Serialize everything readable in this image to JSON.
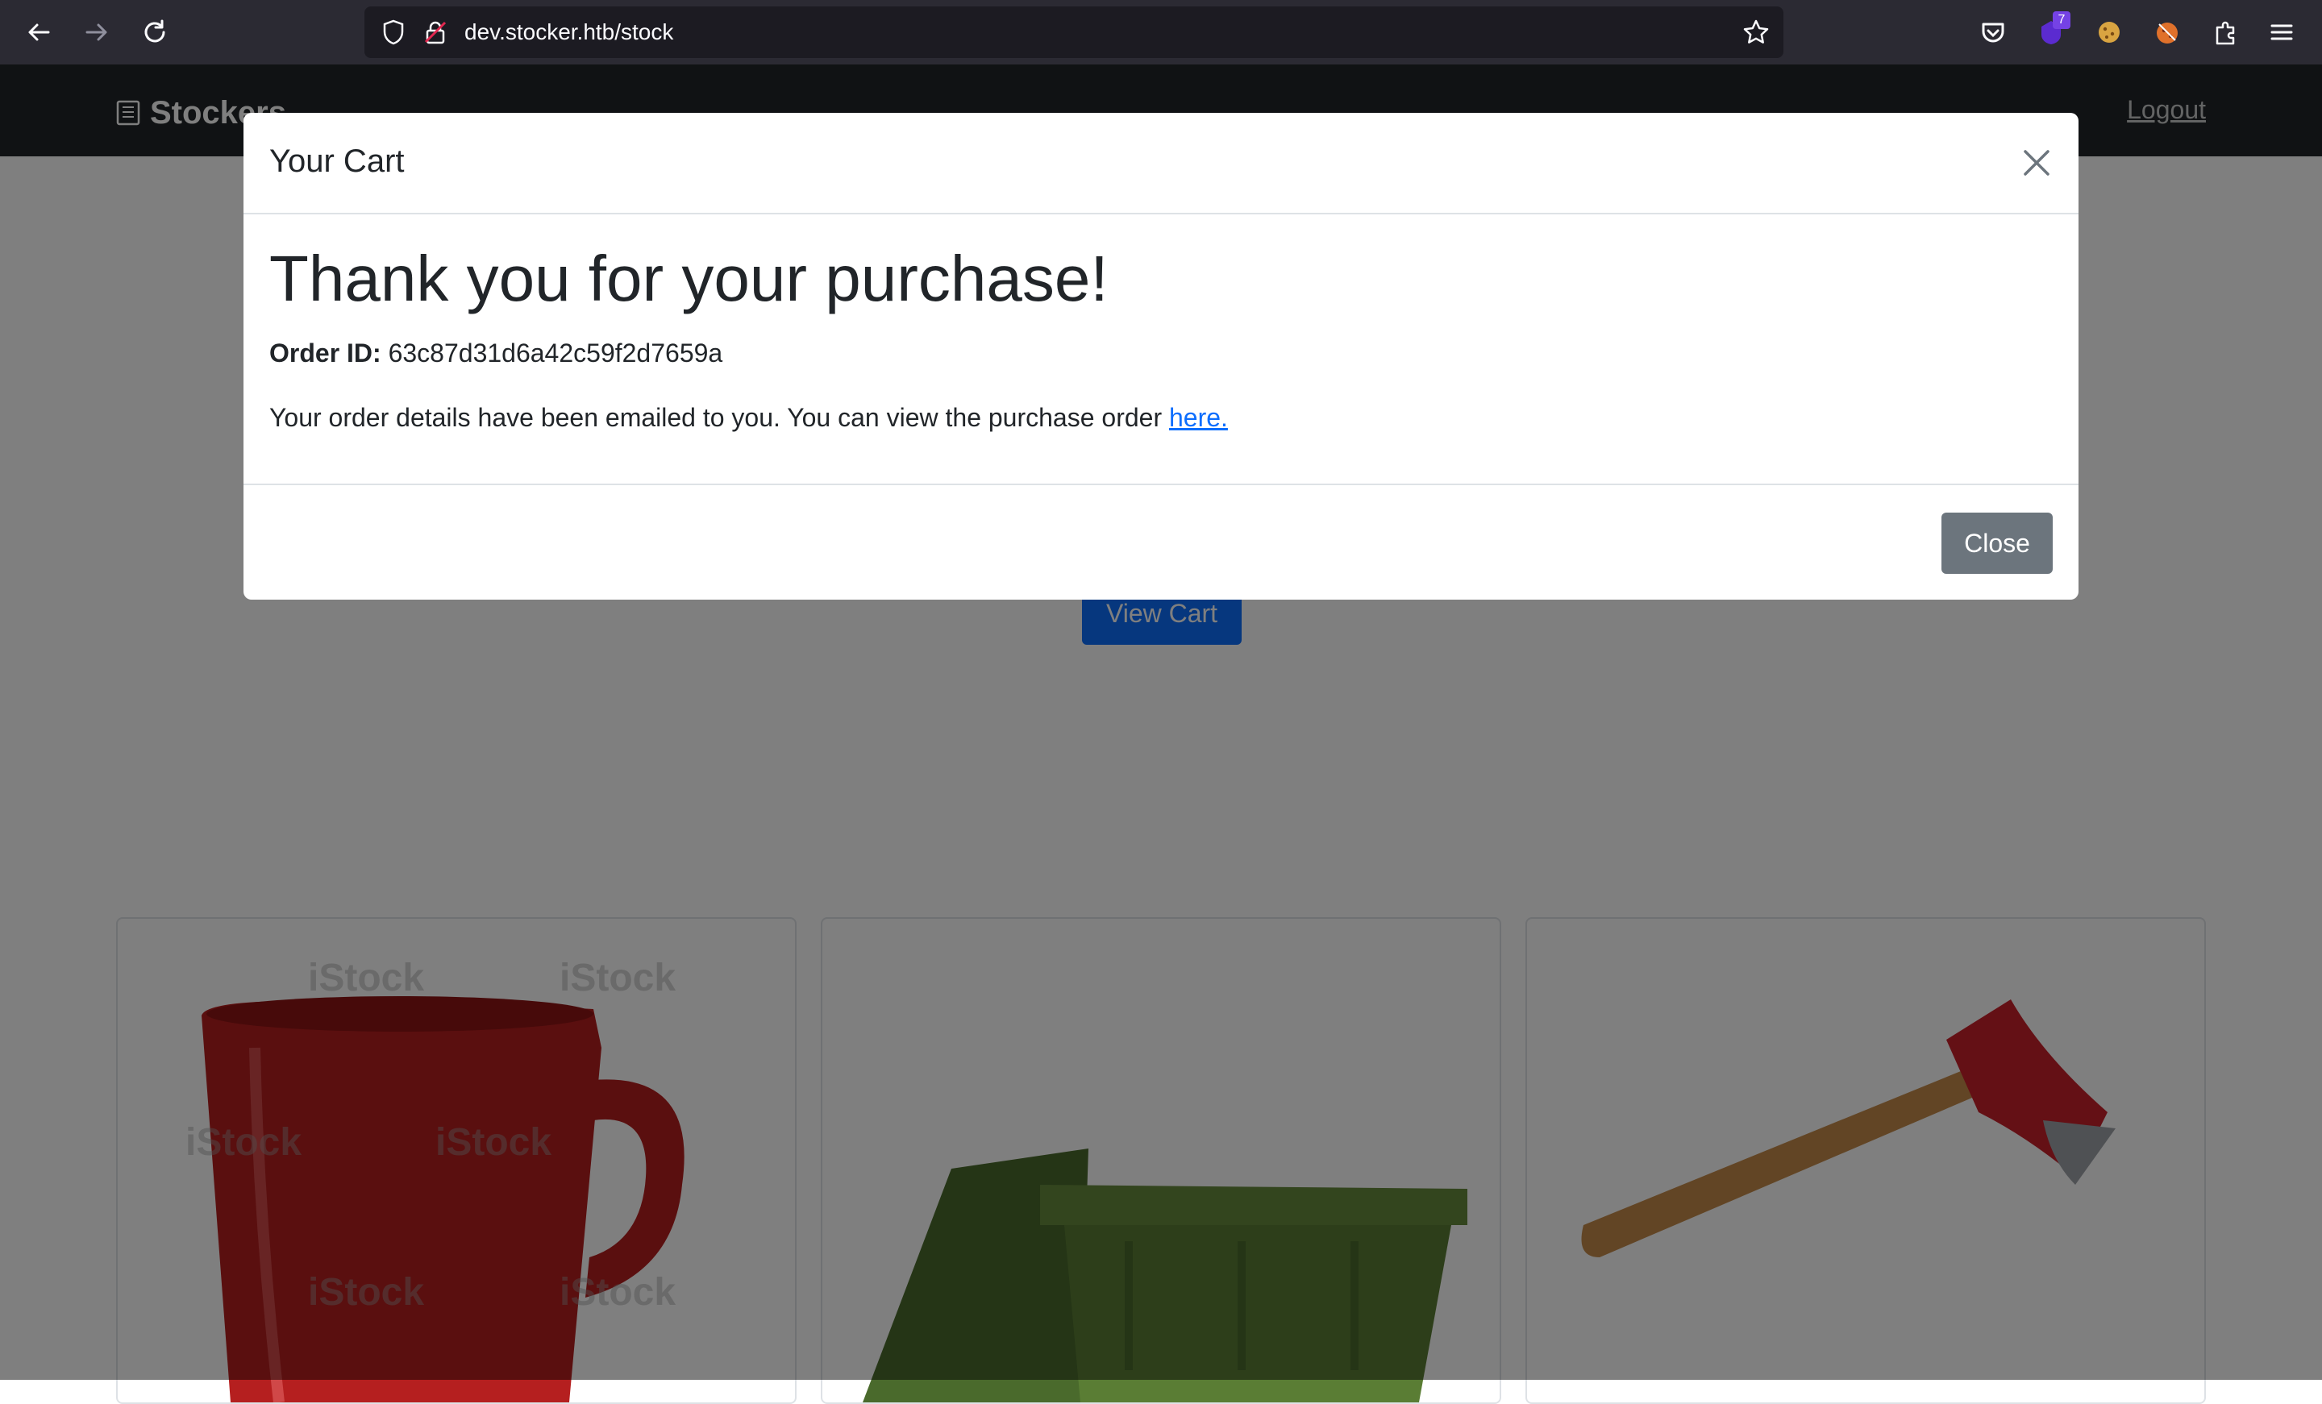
{
  "browser": {
    "url": "dev.stocker.htb/stock",
    "extension_badge": "7"
  },
  "site": {
    "brand": "Stockers",
    "logout_label": "Logout",
    "view_cart_label": "View Cart"
  },
  "products": {
    "watermark": "iStock",
    "items": [
      {
        "icon": "red-mug-image"
      },
      {
        "icon": "green-bin-image"
      },
      {
        "icon": "axe-image"
      }
    ]
  },
  "modal": {
    "title": "Your Cart",
    "heading": "Thank you for your purchase!",
    "order_label": "Order ID:",
    "order_id": "63c87d31d6a42c59f2d7659a",
    "email_text": "Your order details have been emailed to you. You can view the purchase order ",
    "link_label": "here.",
    "close_label": "Close"
  },
  "colors": {
    "browser_bg": "#2b2a33",
    "nav_bg": "#212529",
    "primary": "#0d6efd",
    "secondary": "#6c757d"
  }
}
